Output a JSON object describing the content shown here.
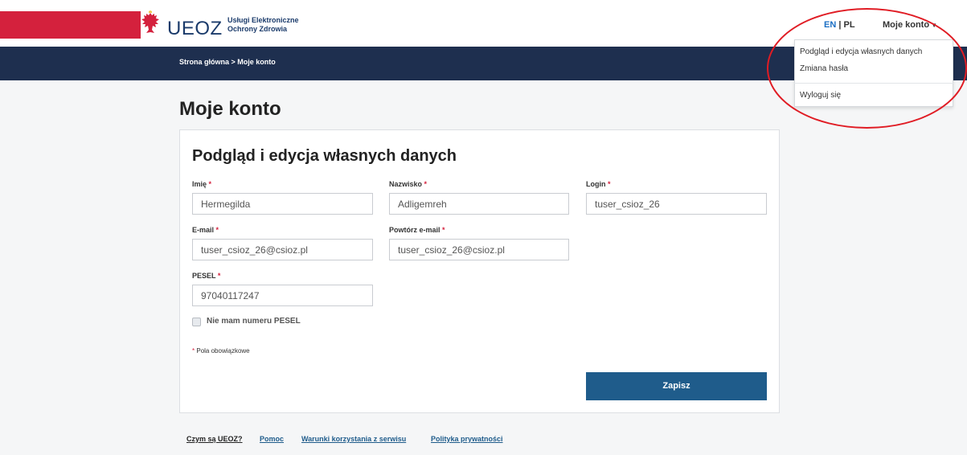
{
  "header": {
    "logo_main": "UEOZ",
    "logo_sub_line1": "Usługi Elektroniczne",
    "logo_sub_line2": "Ochrony Zdrowia",
    "lang_en": "EN",
    "lang_sep": " | ",
    "lang_pl": "PL",
    "account_label": "Moje konto"
  },
  "breadcrumb": "Strona główna > Moje konto",
  "page_title": "Moje konto",
  "form": {
    "title": "Podgląd i edycja własnych danych",
    "first_name": {
      "label": "Imię",
      "value": "Hermegilda"
    },
    "last_name": {
      "label": "Nazwisko",
      "value": "Adligemreh"
    },
    "login": {
      "label": "Login",
      "value": "tuser_csioz_26"
    },
    "email": {
      "label": "E-mail",
      "value": "tuser_csioz_26@csioz.pl"
    },
    "email_repeat": {
      "label": "Powtórz e-mail",
      "value": "tuser_csioz_26@csioz.pl"
    },
    "pesel": {
      "label": "PESEL",
      "value": "97040117247"
    },
    "no_pesel_label": "Nie mam numeru PESEL",
    "required_mark": "*",
    "required_note": "Pola obowiązkowe",
    "save_label": "Zapisz"
  },
  "account_menu": {
    "items": [
      "Podgląd i edycja własnych danych",
      "Zmiana hasła",
      "Wyloguj się"
    ]
  },
  "footer": {
    "links": [
      "Czym są UEOZ?",
      "Pomoc",
      "Warunki korzystania z serwisu",
      "Polityka prywatności"
    ]
  },
  "colors": {
    "brand_red": "#d4213d",
    "nav_dark": "#1e2f4f",
    "primary_button": "#1f5c8b",
    "annotation_circle": "#e01c24"
  }
}
